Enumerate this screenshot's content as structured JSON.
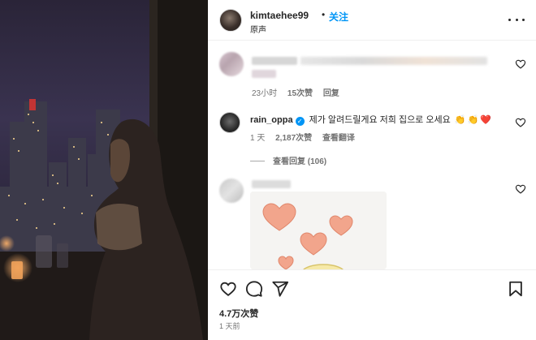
{
  "post": {
    "username": "kimtaehee99",
    "separator": "•",
    "follow_label": "关注",
    "audio_label": "原声"
  },
  "comments": [
    {
      "id": "c1",
      "blurred": true,
      "meta": {
        "time": "23小时",
        "likes": "15次赞",
        "reply": "回复"
      }
    },
    {
      "id": "c2",
      "username": "rain_oppa",
      "verified": true,
      "text": "제가 알려드릴게요 저희 집으로 오세요",
      "emojis": [
        "👏",
        "👏",
        "❤️"
      ],
      "meta": {
        "time": "1 天",
        "likes": "2,187次赞",
        "translate": "查看翻译"
      },
      "view_replies": "查看回复 (106)"
    },
    {
      "id": "c3",
      "blurred": true,
      "has_sticker": true
    }
  ],
  "footer": {
    "likes": "4.7万次赞",
    "time": "1 天前"
  },
  "icons": {
    "more": "more-horizontal-icon",
    "heart": "heart-outline-icon",
    "comment": "comment-bubble-icon",
    "share": "paper-plane-icon",
    "save": "bookmark-icon",
    "verified": "verified-badge-icon"
  },
  "colors": {
    "accent": "#0095f6",
    "text": "#262626",
    "muted": "#737373",
    "heart_emoji": "#ed4956"
  }
}
